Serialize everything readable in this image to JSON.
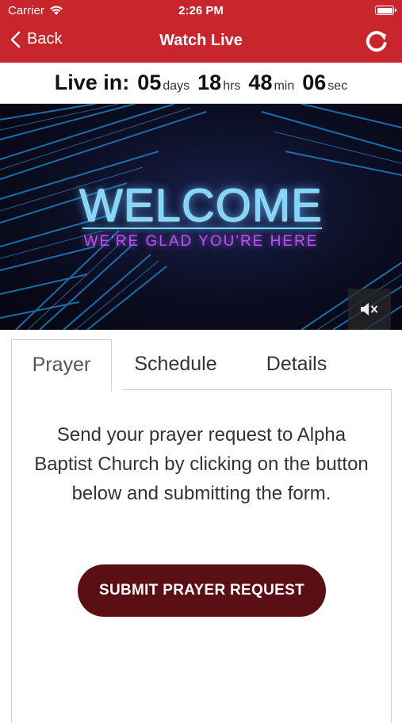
{
  "status_bar": {
    "carrier": "Carrier",
    "time": "2:26 PM"
  },
  "nav": {
    "back_label": "Back",
    "title": "Watch Live"
  },
  "countdown": {
    "label": "Live in:",
    "days": "05",
    "days_unit": "days",
    "hours": "18",
    "hours_unit": "hrs",
    "minutes": "48",
    "minutes_unit": "min",
    "seconds": "06",
    "seconds_unit": "sec"
  },
  "video": {
    "headline": "WELCOME",
    "subline": "WE'RE GLAD YOU'RE HERE"
  },
  "tabs": [
    {
      "label": "Prayer",
      "active": true
    },
    {
      "label": "Schedule",
      "active": false
    },
    {
      "label": "Details",
      "active": false
    }
  ],
  "prayer": {
    "description": "Send your prayer request to Alpha Baptist Church by clicking on the button below and submitting the form.",
    "button_label": "SUBMIT PRAYER REQUEST"
  },
  "colors": {
    "header": "#c8252c",
    "button": "#5a0f14",
    "headline": "#7fd6ff",
    "subline": "#b655f5"
  },
  "icons": [
    "wifi-icon",
    "battery-icon",
    "back-chevron-icon",
    "refresh-icon",
    "mute-icon"
  ]
}
